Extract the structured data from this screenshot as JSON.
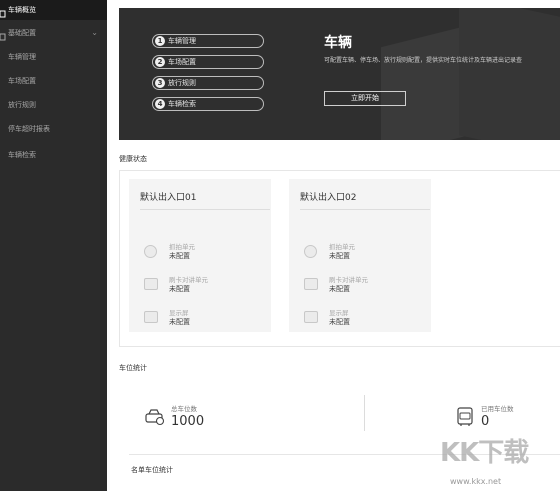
{
  "sidebar": {
    "items": [
      {
        "label": "车辆概览",
        "active": true
      },
      {
        "label": "基础配置",
        "expandable": true
      },
      {
        "label": "车辆管理"
      },
      {
        "label": "车场配置"
      },
      {
        "label": "放行规则"
      },
      {
        "label": "停车超时报表"
      },
      {
        "label": "车辆检索"
      }
    ]
  },
  "hero": {
    "steps": [
      {
        "num": "1",
        "label": "车辆管理"
      },
      {
        "num": "2",
        "label": "车场配置"
      },
      {
        "num": "3",
        "label": "放行规则"
      },
      {
        "num": "4",
        "label": "车辆检索"
      }
    ],
    "title": "车辆",
    "description": "可配置车辆、停车场、放行规则配置，提供实时车位统计及车辆进出记录查",
    "start_button": "立即开始"
  },
  "health": {
    "title": "健康状态",
    "entrances": [
      {
        "name": "默认出入口01",
        "units": [
          {
            "icon": "camera-icon",
            "name": "抓拍单元",
            "status": "未配置"
          },
          {
            "icon": "card-reader-icon",
            "name": "刷卡对讲单元",
            "status": "未配置"
          },
          {
            "icon": "display-screen-icon",
            "name": "显示屏",
            "status": "未配置"
          }
        ]
      },
      {
        "name": "默认出入口02",
        "units": [
          {
            "icon": "camera-icon",
            "name": "抓拍单元",
            "status": "未配置"
          },
          {
            "icon": "card-reader-icon",
            "name": "刷卡对讲单元",
            "status": "未配置"
          },
          {
            "icon": "display-screen-icon",
            "name": "显示屏",
            "status": "未配置"
          }
        ]
      }
    ]
  },
  "parking": {
    "title": "车位统计",
    "total": {
      "label": "总车位数",
      "value": "1000"
    },
    "used": {
      "label": "已用车位数",
      "value": "0"
    },
    "list_title": "名单车位统计"
  },
  "watermark": {
    "text": "KK下载",
    "url": "www.kkx.net"
  }
}
